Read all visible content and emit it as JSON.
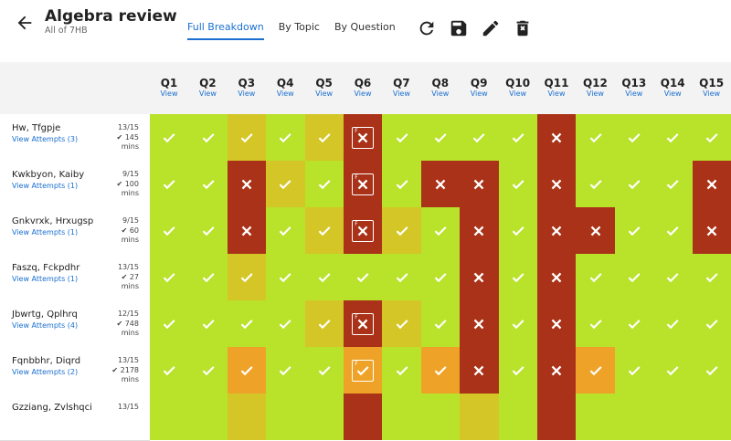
{
  "header": {
    "title": "Algebra review",
    "subtitle": "All of 7HB"
  },
  "tabs": [
    {
      "label": "Full Breakdown",
      "active": true
    },
    {
      "label": "By Topic",
      "active": false
    },
    {
      "label": "By Question",
      "active": false
    }
  ],
  "toolbar_icons": [
    "refresh-icon",
    "save-icon",
    "edit-icon",
    "delete-icon"
  ],
  "questions": [
    {
      "label": "Q1",
      "link": "View"
    },
    {
      "label": "Q2",
      "link": "View"
    },
    {
      "label": "Q3",
      "link": "View"
    },
    {
      "label": "Q4",
      "link": "View"
    },
    {
      "label": "Q5",
      "link": "View"
    },
    {
      "label": "Q6",
      "link": "View"
    },
    {
      "label": "Q7",
      "link": "View"
    },
    {
      "label": "Q8",
      "link": "View"
    },
    {
      "label": "Q9",
      "link": "View"
    },
    {
      "label": "Q10",
      "link": "View"
    },
    {
      "label": "Q11",
      "link": "View"
    },
    {
      "label": "Q12",
      "link": "View"
    },
    {
      "label": "Q13",
      "link": "View"
    },
    {
      "label": "Q14",
      "link": "View"
    },
    {
      "label": "Q15",
      "link": "View"
    }
  ],
  "colors": {
    "green": "#b9e22b",
    "lightyellow": "#d4c626",
    "orange": "#eea328",
    "red": "#a93218",
    "link": "#1a6fd0"
  },
  "students": [
    {
      "name": "Hw, Tfgpje",
      "attempts": "View Attempts (3)",
      "score": "13/15",
      "time": "145",
      "unit": "mins",
      "cells": [
        [
          "g",
          "c"
        ],
        [
          "g",
          "c"
        ],
        [
          "y",
          "c"
        ],
        [
          "g",
          "c"
        ],
        [
          "y",
          "c"
        ],
        [
          "r",
          "xf"
        ],
        [
          "g",
          "c"
        ],
        [
          "g",
          "c"
        ],
        [
          "g",
          "c"
        ],
        [
          "g",
          "c"
        ],
        [
          "r",
          "x"
        ],
        [
          "g",
          "c"
        ],
        [
          "g",
          "c"
        ],
        [
          "g",
          "c"
        ],
        [
          "g",
          "c"
        ]
      ]
    },
    {
      "name": "Kwkbyon, Kaiby",
      "attempts": "View Attempts (1)",
      "score": "9/15",
      "time": "100",
      "unit": "mins",
      "cells": [
        [
          "g",
          "c"
        ],
        [
          "g",
          "c"
        ],
        [
          "r",
          "x"
        ],
        [
          "y",
          "c"
        ],
        [
          "g",
          "c"
        ],
        [
          "r",
          "xf"
        ],
        [
          "g",
          "c"
        ],
        [
          "r",
          "x"
        ],
        [
          "r",
          "x"
        ],
        [
          "g",
          "c"
        ],
        [
          "r",
          "x"
        ],
        [
          "g",
          "c"
        ],
        [
          "g",
          "c"
        ],
        [
          "g",
          "c"
        ],
        [
          "r",
          "x"
        ]
      ]
    },
    {
      "name": "Gnkvrxk, Hrxugsp",
      "attempts": "View Attempts (1)",
      "score": "9/15",
      "time": "60",
      "unit": "mins",
      "cells": [
        [
          "g",
          "c"
        ],
        [
          "g",
          "c"
        ],
        [
          "r",
          "x"
        ],
        [
          "g",
          "c"
        ],
        [
          "y",
          "c"
        ],
        [
          "r",
          "xf"
        ],
        [
          "y",
          "c"
        ],
        [
          "g",
          "c"
        ],
        [
          "r",
          "x"
        ],
        [
          "g",
          "c"
        ],
        [
          "r",
          "x"
        ],
        [
          "r",
          "x"
        ],
        [
          "g",
          "c"
        ],
        [
          "g",
          "c"
        ],
        [
          "r",
          "x"
        ]
      ]
    },
    {
      "name": "Faszq, Fckpdhr",
      "attempts": "View Attempts (1)",
      "score": "13/15",
      "time": "27",
      "unit": "mins",
      "cells": [
        [
          "g",
          "c"
        ],
        [
          "g",
          "c"
        ],
        [
          "y",
          "c"
        ],
        [
          "g",
          "c"
        ],
        [
          "g",
          "c"
        ],
        [
          "g",
          "c"
        ],
        [
          "g",
          "c"
        ],
        [
          "g",
          "c"
        ],
        [
          "r",
          "x"
        ],
        [
          "g",
          "c"
        ],
        [
          "r",
          "x"
        ],
        [
          "g",
          "c"
        ],
        [
          "g",
          "c"
        ],
        [
          "g",
          "c"
        ],
        [
          "g",
          "c"
        ]
      ]
    },
    {
      "name": "Jbwrtg, Qplhrq",
      "attempts": "View Attempts (4)",
      "score": "12/15",
      "time": "748",
      "unit": "mins",
      "cells": [
        [
          "g",
          "c"
        ],
        [
          "g",
          "c"
        ],
        [
          "g",
          "c"
        ],
        [
          "g",
          "c"
        ],
        [
          "y",
          "c"
        ],
        [
          "r",
          "xf"
        ],
        [
          "y",
          "c"
        ],
        [
          "g",
          "c"
        ],
        [
          "r",
          "x"
        ],
        [
          "g",
          "c"
        ],
        [
          "r",
          "x"
        ],
        [
          "g",
          "c"
        ],
        [
          "g",
          "c"
        ],
        [
          "g",
          "c"
        ],
        [
          "g",
          "c"
        ]
      ]
    },
    {
      "name": "Fqnbbhr, Diqrd",
      "attempts": "View Attempts (2)",
      "score": "13/15",
      "time": "2178",
      "unit": "mins",
      "cells": [
        [
          "g",
          "c"
        ],
        [
          "g",
          "c"
        ],
        [
          "o",
          "c"
        ],
        [
          "g",
          "c"
        ],
        [
          "g",
          "c"
        ],
        [
          "o",
          "cf"
        ],
        [
          "g",
          "c"
        ],
        [
          "o",
          "c"
        ],
        [
          "r",
          "x"
        ],
        [
          "g",
          "c"
        ],
        [
          "r",
          "x"
        ],
        [
          "o",
          "c"
        ],
        [
          "g",
          "c"
        ],
        [
          "g",
          "c"
        ],
        [
          "g",
          "c"
        ]
      ]
    },
    {
      "name": "Gzziang, Zvlshqci",
      "attempts": "",
      "score": "13/15",
      "time": "",
      "unit": "",
      "cells": [
        [
          "g",
          ""
        ],
        [
          "g",
          ""
        ],
        [
          "y",
          ""
        ],
        [
          "g",
          ""
        ],
        [
          "g",
          ""
        ],
        [
          "r",
          ""
        ],
        [
          "g",
          ""
        ],
        [
          "g",
          ""
        ],
        [
          "y",
          ""
        ],
        [
          "g",
          ""
        ],
        [
          "r",
          ""
        ],
        [
          "g",
          ""
        ],
        [
          "g",
          ""
        ],
        [
          "g",
          ""
        ],
        [
          "g",
          ""
        ]
      ]
    }
  ]
}
